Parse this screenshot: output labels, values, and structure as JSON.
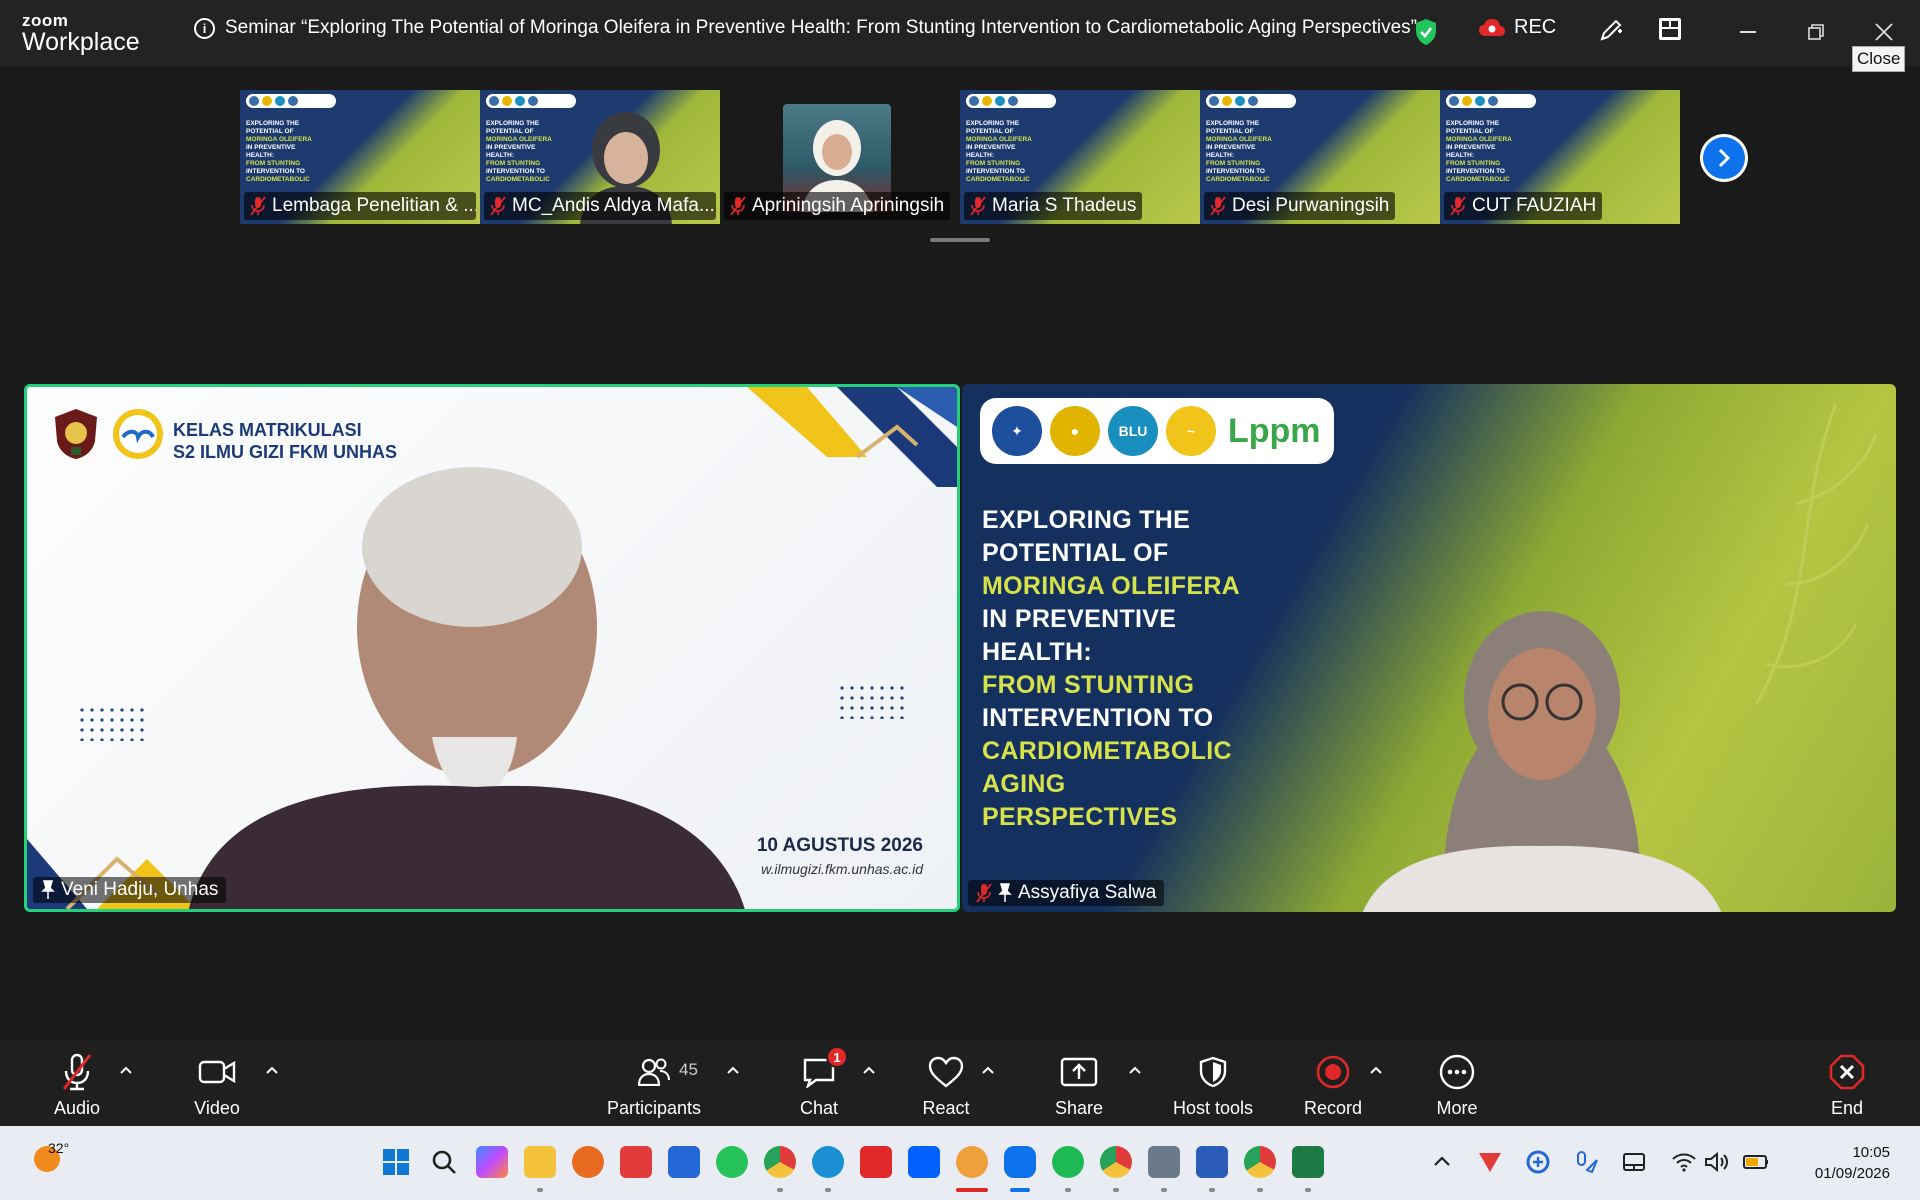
{
  "app": {
    "logo_top": "zoom",
    "logo_bottom": "Workplace",
    "meeting_title": "Seminar “Exploring The Potential of Moringa Oleifera in Preventive Health: From Stunting Intervention to Cardiometabolic Aging Perspectives”",
    "rec_label": "REC",
    "close_tooltip": "Close"
  },
  "thumbnails": [
    {
      "name": "Lembaga Penelitian & ...",
      "kind": "slide"
    },
    {
      "name": "MC_Andis Aldya Mafa...",
      "kind": "slide-person"
    },
    {
      "name": "Apriningsih Apriningsih",
      "kind": "photo"
    },
    {
      "name": "Maria S Thadeus",
      "kind": "slide"
    },
    {
      "name": "Desi Purwaningsih",
      "kind": "slide"
    },
    {
      "name": "CUT FAUZIAH",
      "kind": "slide"
    }
  ],
  "thumb_slide_text": {
    "l1": "EXPLORING THE",
    "l2": "POTENTIAL OF",
    "l3": "MORINGA OLEIFERA",
    "l4": "IN PREVENTIVE",
    "l5": "HEALTH:",
    "l6": "FROM STUNTING",
    "l7": "INTERVENTION TO",
    "l8": "CARDIOMETABOLIC"
  },
  "left_video": {
    "banner_line1": "KELAS MATRIKULASI",
    "banner_line2": "S2 ILMU GIZI FKM UNHAS",
    "date": "10 AGUSTUS 2026",
    "url": "w.ilmugizi.fkm.unhas.ac.id",
    "speaker": "Veni Hadju, Unhas"
  },
  "right_video": {
    "logo_blu": "BLU",
    "logo_lppm": "Lppm",
    "title_lines": [
      {
        "text": "EXPLORING THE",
        "hl": false
      },
      {
        "text": "POTENTIAL OF",
        "hl": false
      },
      {
        "text": "MORINGA OLEIFERA",
        "hl": true
      },
      {
        "text": "IN PREVENTIVE",
        "hl": false
      },
      {
        "text": "HEALTH:",
        "hl": false
      },
      {
        "text": "FROM STUNTING",
        "hl": true
      },
      {
        "text": "INTERVENTION TO",
        "hl": false
      },
      {
        "text": "CARDIOMETABOLIC",
        "hl": true
      },
      {
        "text": "AGING",
        "hl": true
      },
      {
        "text": "PERSPECTIVES",
        "hl": true
      }
    ],
    "speaker": "Assyafiya Salwa"
  },
  "toolbar": {
    "audio": "Audio",
    "video": "Video",
    "participants": "Participants",
    "participants_count": "45",
    "chat": "Chat",
    "chat_badge": "1",
    "react": "React",
    "share": "Share",
    "host_tools": "Host tools",
    "record": "Record",
    "more": "More",
    "end": "End"
  },
  "taskbar": {
    "temperature": "32°",
    "time": "10:05",
    "date": "01/09/2026"
  },
  "colors": {
    "accent_blue": "#0e72ed",
    "active_speaker": "#25d07a",
    "record_red": "#e02828",
    "slide_highlight": "#d7e24b"
  }
}
